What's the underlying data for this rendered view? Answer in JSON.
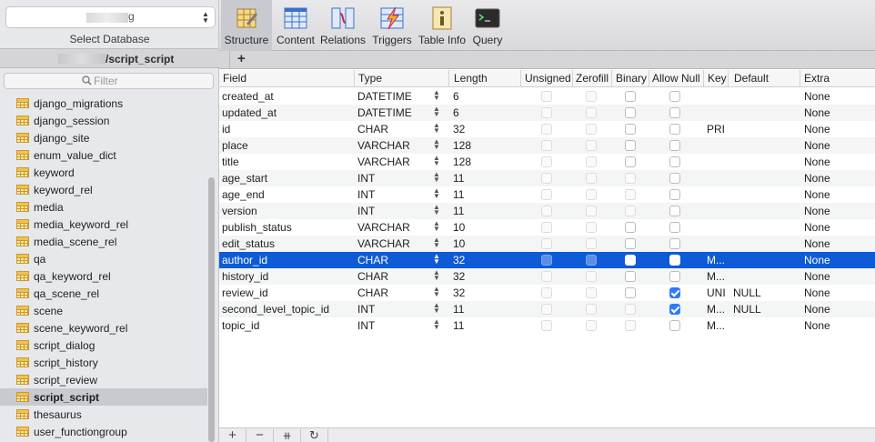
{
  "sidebar": {
    "db_select_value": "g",
    "select_label": "Select Database",
    "db_tab_label": "/script_script",
    "filter_placeholder": "Filter",
    "tables": [
      "django_migrations",
      "django_session",
      "django_site",
      "enum_value_dict",
      "keyword",
      "keyword_rel",
      "media",
      "media_keyword_rel",
      "media_scene_rel",
      "qa",
      "qa_keyword_rel",
      "qa_scene_rel",
      "scene",
      "scene_keyword_rel",
      "script_dialog",
      "script_history",
      "script_review",
      "script_script",
      "thesaurus",
      "user_functiongroup"
    ],
    "selected_table": "script_script"
  },
  "toolbar": {
    "structure": "Structure",
    "content": "Content",
    "relations": "Relations",
    "triggers": "Triggers",
    "table_info": "Table Info",
    "query": "Query"
  },
  "grid": {
    "headers": {
      "field": "Field",
      "type": "Type",
      "length": "Length",
      "unsigned": "Unsigned",
      "zerofill": "Zerofill",
      "binary": "Binary",
      "allow_null": "Allow Null",
      "key": "Key",
      "default": "Default",
      "extra": "Extra"
    },
    "rows": [
      {
        "field": "created_at",
        "type": "DATETIME",
        "length": "6",
        "key": "",
        "default": "",
        "extra": "None",
        "unsigned": false,
        "zerofill": false,
        "binary": false,
        "allow_null": false
      },
      {
        "field": "updated_at",
        "type": "DATETIME",
        "length": "6",
        "key": "",
        "default": "",
        "extra": "None",
        "unsigned": false,
        "zerofill": false,
        "binary": false,
        "allow_null": false
      },
      {
        "field": "id",
        "type": "CHAR",
        "length": "32",
        "key": "PRI",
        "default": "",
        "extra": "None",
        "unsigned": false,
        "zerofill": false,
        "binary": false,
        "allow_null": false
      },
      {
        "field": "place",
        "type": "VARCHAR",
        "length": "128",
        "key": "",
        "default": "",
        "extra": "None",
        "unsigned": false,
        "zerofill": false,
        "binary": false,
        "allow_null": false
      },
      {
        "field": "title",
        "type": "VARCHAR",
        "length": "128",
        "key": "",
        "default": "",
        "extra": "None",
        "unsigned": false,
        "zerofill": false,
        "binary": false,
        "allow_null": false
      },
      {
        "field": "age_start",
        "type": "INT",
        "length": "11",
        "key": "",
        "default": "",
        "extra": "None",
        "unsigned": false,
        "zerofill": false,
        "binary": false,
        "allow_null": false
      },
      {
        "field": "age_end",
        "type": "INT",
        "length": "11",
        "key": "",
        "default": "",
        "extra": "None",
        "unsigned": false,
        "zerofill": false,
        "binary": false,
        "allow_null": false
      },
      {
        "field": "version",
        "type": "INT",
        "length": "11",
        "key": "",
        "default": "",
        "extra": "None",
        "unsigned": false,
        "zerofill": false,
        "binary": false,
        "allow_null": false
      },
      {
        "field": "publish_status",
        "type": "VARCHAR",
        "length": "10",
        "key": "",
        "default": "",
        "extra": "None",
        "unsigned": false,
        "zerofill": false,
        "binary": false,
        "allow_null": false
      },
      {
        "field": "edit_status",
        "type": "VARCHAR",
        "length": "10",
        "key": "",
        "default": "",
        "extra": "None",
        "unsigned": false,
        "zerofill": false,
        "binary": false,
        "allow_null": false
      },
      {
        "field": "author_id",
        "type": "CHAR",
        "length": "32",
        "key": "M...",
        "default": "",
        "extra": "None",
        "unsigned": false,
        "zerofill": false,
        "binary": false,
        "allow_null": false
      },
      {
        "field": "history_id",
        "type": "CHAR",
        "length": "32",
        "key": "M...",
        "default": "",
        "extra": "None",
        "unsigned": false,
        "zerofill": false,
        "binary": false,
        "allow_null": false
      },
      {
        "field": "review_id",
        "type": "CHAR",
        "length": "32",
        "key": "UNI",
        "default": "NULL",
        "extra": "None",
        "unsigned": false,
        "zerofill": false,
        "binary": false,
        "allow_null": true
      },
      {
        "field": "second_level_topic_id",
        "type": "INT",
        "length": "11",
        "key": "M...",
        "default": "NULL",
        "extra": "None",
        "unsigned": false,
        "zerofill": false,
        "binary": false,
        "allow_null": true
      },
      {
        "field": "topic_id",
        "type": "INT",
        "length": "11",
        "key": "M...",
        "default": "",
        "extra": "None",
        "unsigned": false,
        "zerofill": false,
        "binary": false,
        "allow_null": false
      }
    ],
    "selected_row": 10
  },
  "bottombar": {
    "add": "+",
    "remove": "−",
    "duplicate": "⧺",
    "refresh": "↻"
  },
  "colors": {
    "selection": "#0d5bd6",
    "checkbox_on": "#2f7bf5",
    "table_icon": "#f1c24f"
  }
}
